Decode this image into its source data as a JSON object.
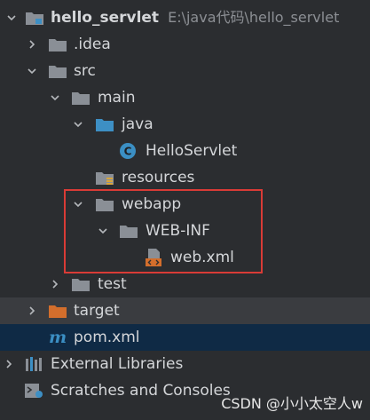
{
  "project": {
    "name": "hello_servlet",
    "path": "E:\\java代码\\hello_servlet"
  },
  "tree": {
    "idea": ".idea",
    "src": "src",
    "main": "main",
    "java": "java",
    "hello_servlet_class": "HelloServlet",
    "resources": "resources",
    "webapp": "webapp",
    "web_inf": "WEB-INF",
    "web_xml": "web.xml",
    "test": "test",
    "target": "target",
    "pom": "pom.xml",
    "external_libraries": "External Libraries",
    "scratches": "Scratches and Consoles"
  },
  "watermark": "CSDN @小小太空人w",
  "colors": {
    "folder": "#8a8f96",
    "source_folder": "#3d8fc4",
    "excluded_folder": "#d36e2c",
    "class_icon": "#3b8fc4",
    "maven_icon": "#3b8fc4",
    "highlight": "#d93b36"
  }
}
